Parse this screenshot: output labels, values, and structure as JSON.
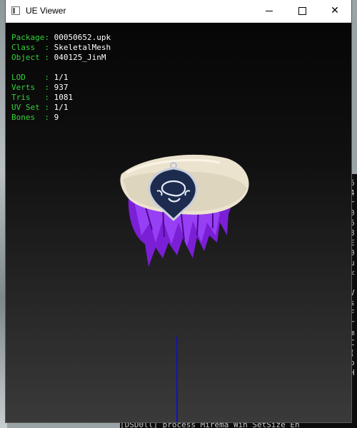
{
  "window": {
    "title": "UE Viewer",
    "controls": {
      "minimize": "minimize-icon",
      "maximize": "maximize-icon",
      "close": "close-icon"
    }
  },
  "info": {
    "package_label": "Package",
    "package_value": "00050652.upk",
    "class_label": "Class  ",
    "class_value": "SkeletalMesh",
    "object_label": "Object ",
    "object_value": "040125_JinM",
    "lod_label": "LOD    ",
    "lod_value": "1/1",
    "verts_label": "Verts  ",
    "verts_value": "937",
    "tris_label": "Tris   ",
    "tris_value": "1081",
    "uvset_label": "UV Set ",
    "uvset_value": "1/1",
    "bones_label": "Bones  ",
    "bones_value": "9"
  },
  "colors": {
    "label_green": "#36d13a",
    "value_white": "#ffffff",
    "hair_purple": "#8a2be2",
    "hat_cream": "#ece3cf",
    "emblem_navy": "#1d2b4f",
    "axis_blue": "#1010c8"
  },
  "background": {
    "console_right": "6\n4\nr\n0\n6\n8\nE\n0\nu\n<\n\nV\ns\nF\nr\nm\nC\n(\no\nH",
    "console_bottom": "[DSD0ll] process  Mirema Win SetSize  En"
  }
}
